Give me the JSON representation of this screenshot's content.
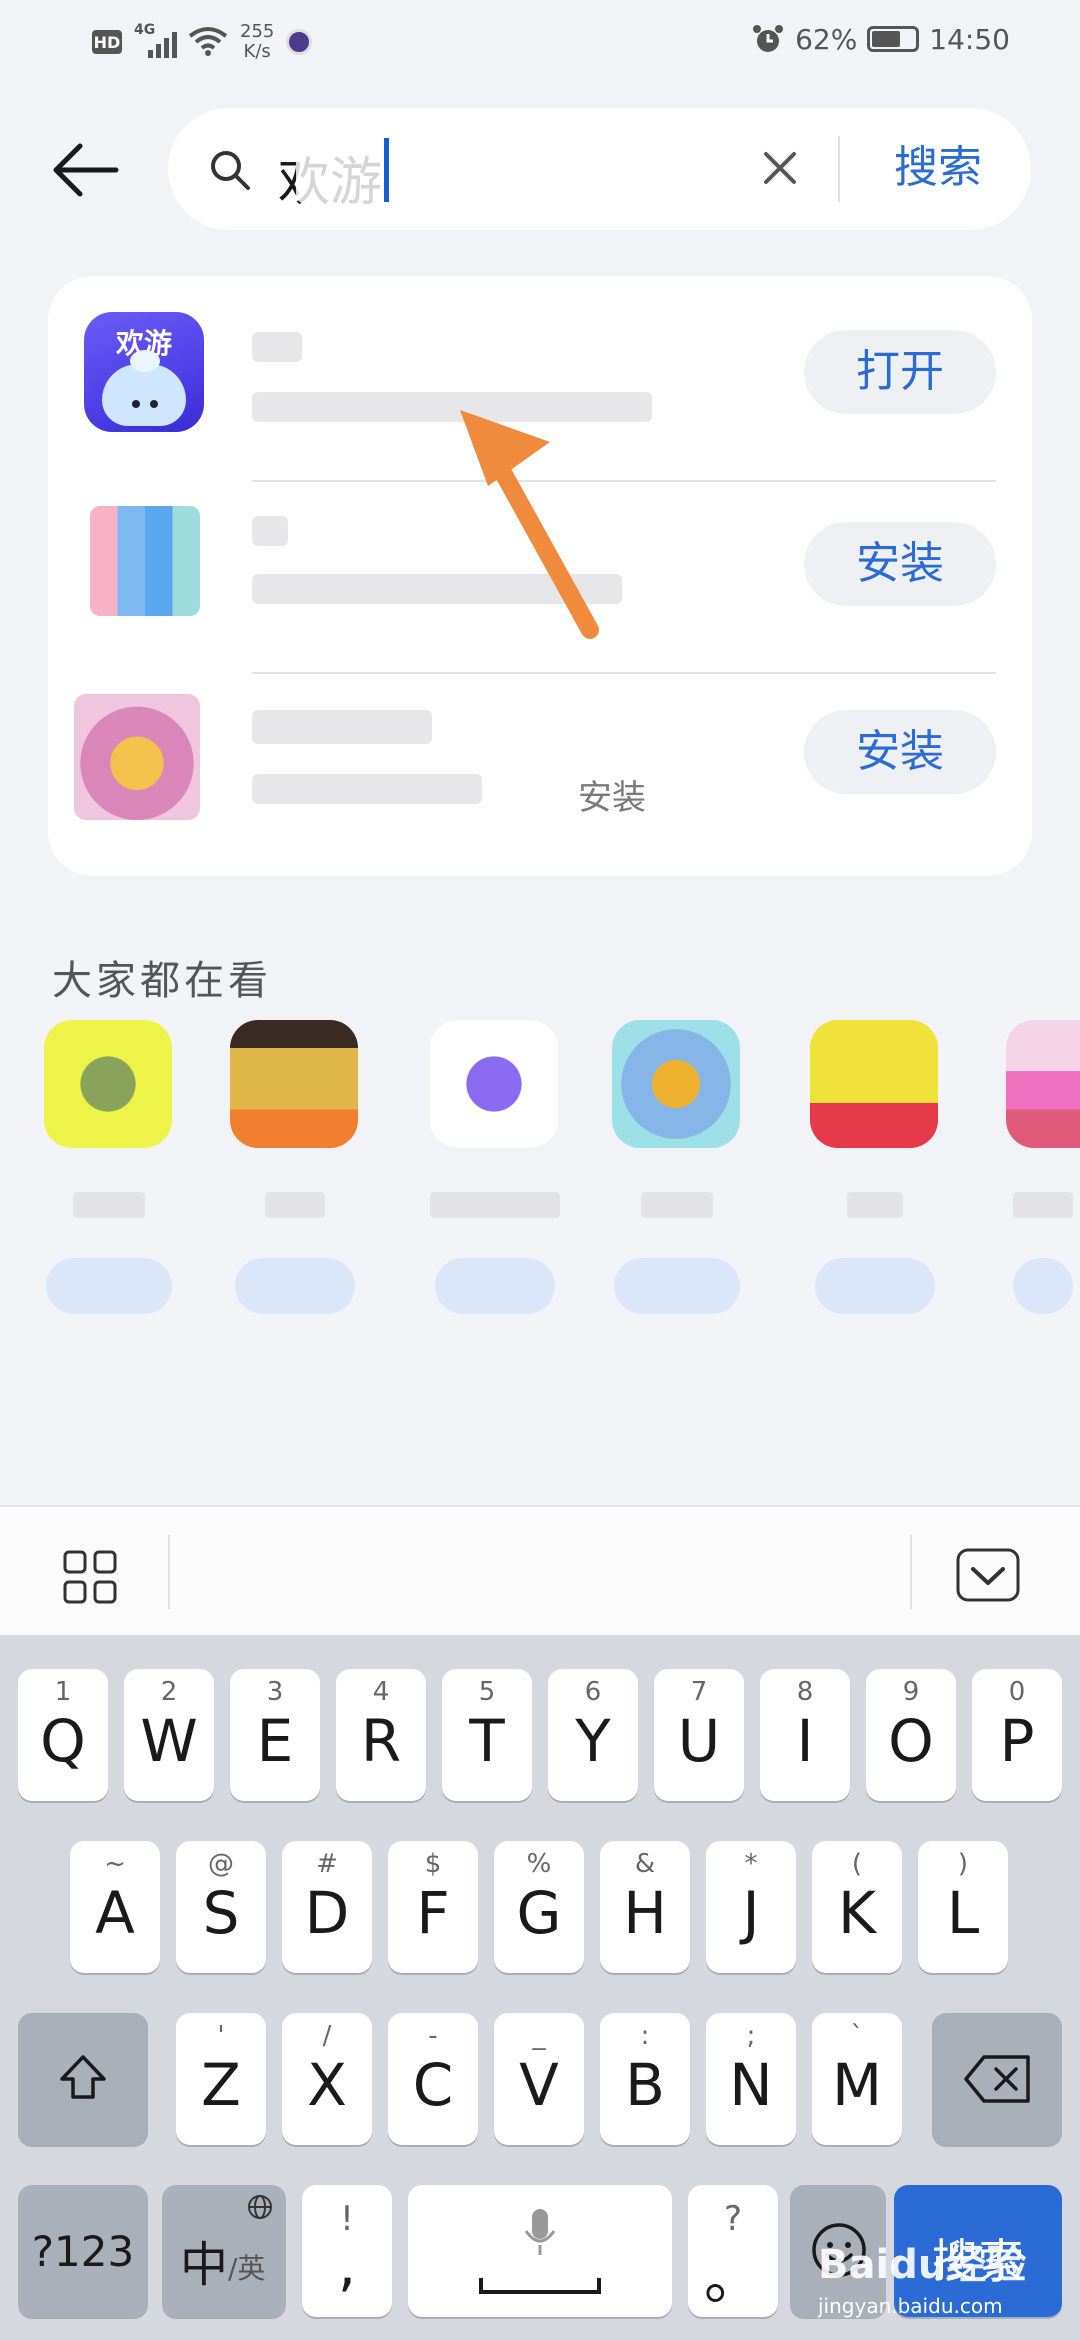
{
  "status_bar": {
    "hd": "HD",
    "network": "4G",
    "speed_value": "255",
    "speed_unit": "K/s",
    "battery": "62%",
    "time": "14:50"
  },
  "search": {
    "value": "欢游",
    "action_label": "搜索"
  },
  "results": [
    {
      "app_icon_text": "欢游",
      "action": "打开"
    },
    {
      "action": "安装"
    },
    {
      "action": "安装",
      "subtitle_tail": "安装"
    }
  ],
  "section": {
    "title": "大家都在看"
  },
  "keyboard": {
    "row1": [
      {
        "num": "1",
        "letter": "Q"
      },
      {
        "num": "2",
        "letter": "W"
      },
      {
        "num": "3",
        "letter": "E"
      },
      {
        "num": "4",
        "letter": "R"
      },
      {
        "num": "5",
        "letter": "T"
      },
      {
        "num": "6",
        "letter": "Y"
      },
      {
        "num": "7",
        "letter": "U"
      },
      {
        "num": "8",
        "letter": "I"
      },
      {
        "num": "9",
        "letter": "O"
      },
      {
        "num": "0",
        "letter": "P"
      }
    ],
    "row2": [
      {
        "sym": "~",
        "letter": "A"
      },
      {
        "sym": "@",
        "letter": "S"
      },
      {
        "sym": "#",
        "letter": "D"
      },
      {
        "sym": "$",
        "letter": "F"
      },
      {
        "sym": "%",
        "letter": "G"
      },
      {
        "sym": "&",
        "letter": "H"
      },
      {
        "sym": "*",
        "letter": "J"
      },
      {
        "sym": "(",
        "letter": "K"
      },
      {
        "sym": ")",
        "letter": "L"
      }
    ],
    "row3": [
      {
        "sym": "'",
        "letter": "Z"
      },
      {
        "sym": "/",
        "letter": "X"
      },
      {
        "sym": "-",
        "letter": "C"
      },
      {
        "sym": "_",
        "letter": "V"
      },
      {
        "sym": ":",
        "letter": "B"
      },
      {
        "sym": ";",
        "letter": "N"
      },
      {
        "sym": "`",
        "letter": "M"
      }
    ],
    "num_switch": "?123",
    "lang_main": "中",
    "lang_alt": "/英",
    "comma_sup": "!",
    "comma": ",",
    "period_sup": "?",
    "period": "。",
    "enter_label": "搜索"
  },
  "watermark": {
    "brand": "Baidu经验",
    "url": "jingyan.baidu.com"
  },
  "colors": {
    "accent": "#2b6bd6",
    "arrow": "#f08a3c",
    "background": "#f2f3f6"
  }
}
